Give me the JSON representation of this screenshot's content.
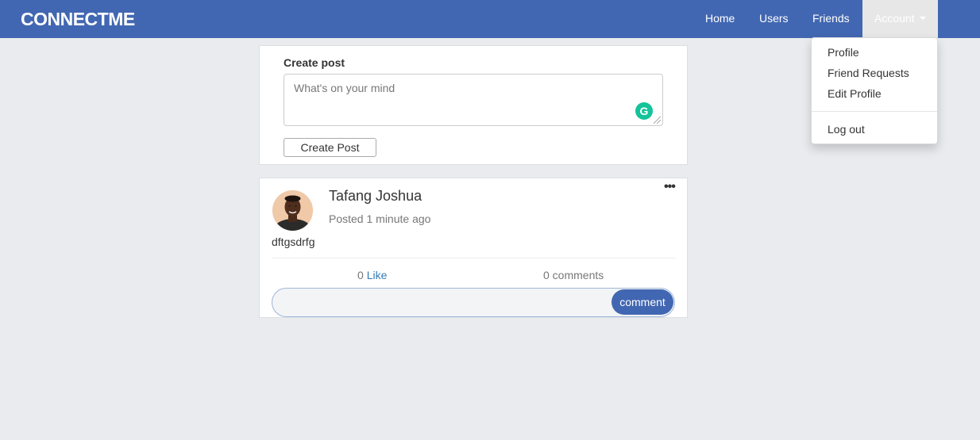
{
  "app": {
    "brand": "CONNECTME"
  },
  "nav": {
    "home": "Home",
    "users": "Users",
    "friends": "Friends",
    "account": "Account"
  },
  "account_menu": {
    "profile": "Profile",
    "friend_requests": "Friend Requests",
    "edit_profile": "Edit Profile",
    "log_out": "Log out"
  },
  "create_post": {
    "title": "Create post",
    "placeholder": "What's on your mind",
    "button": "Create Post"
  },
  "post": {
    "author": "Tafang Joshua",
    "posted_prefix": "Posted",
    "posted_time": "1 minute ago",
    "body": "dftgsdrfg",
    "like_count": "0",
    "like_label": "Like",
    "comments": "0 comments",
    "comment_button": "comment",
    "more_icon": "ellipsis-icon"
  },
  "colors": {
    "brand": "#4267b2",
    "background": "#e9ebee",
    "grammarly": "#15c39a",
    "link": "#337ab7"
  }
}
